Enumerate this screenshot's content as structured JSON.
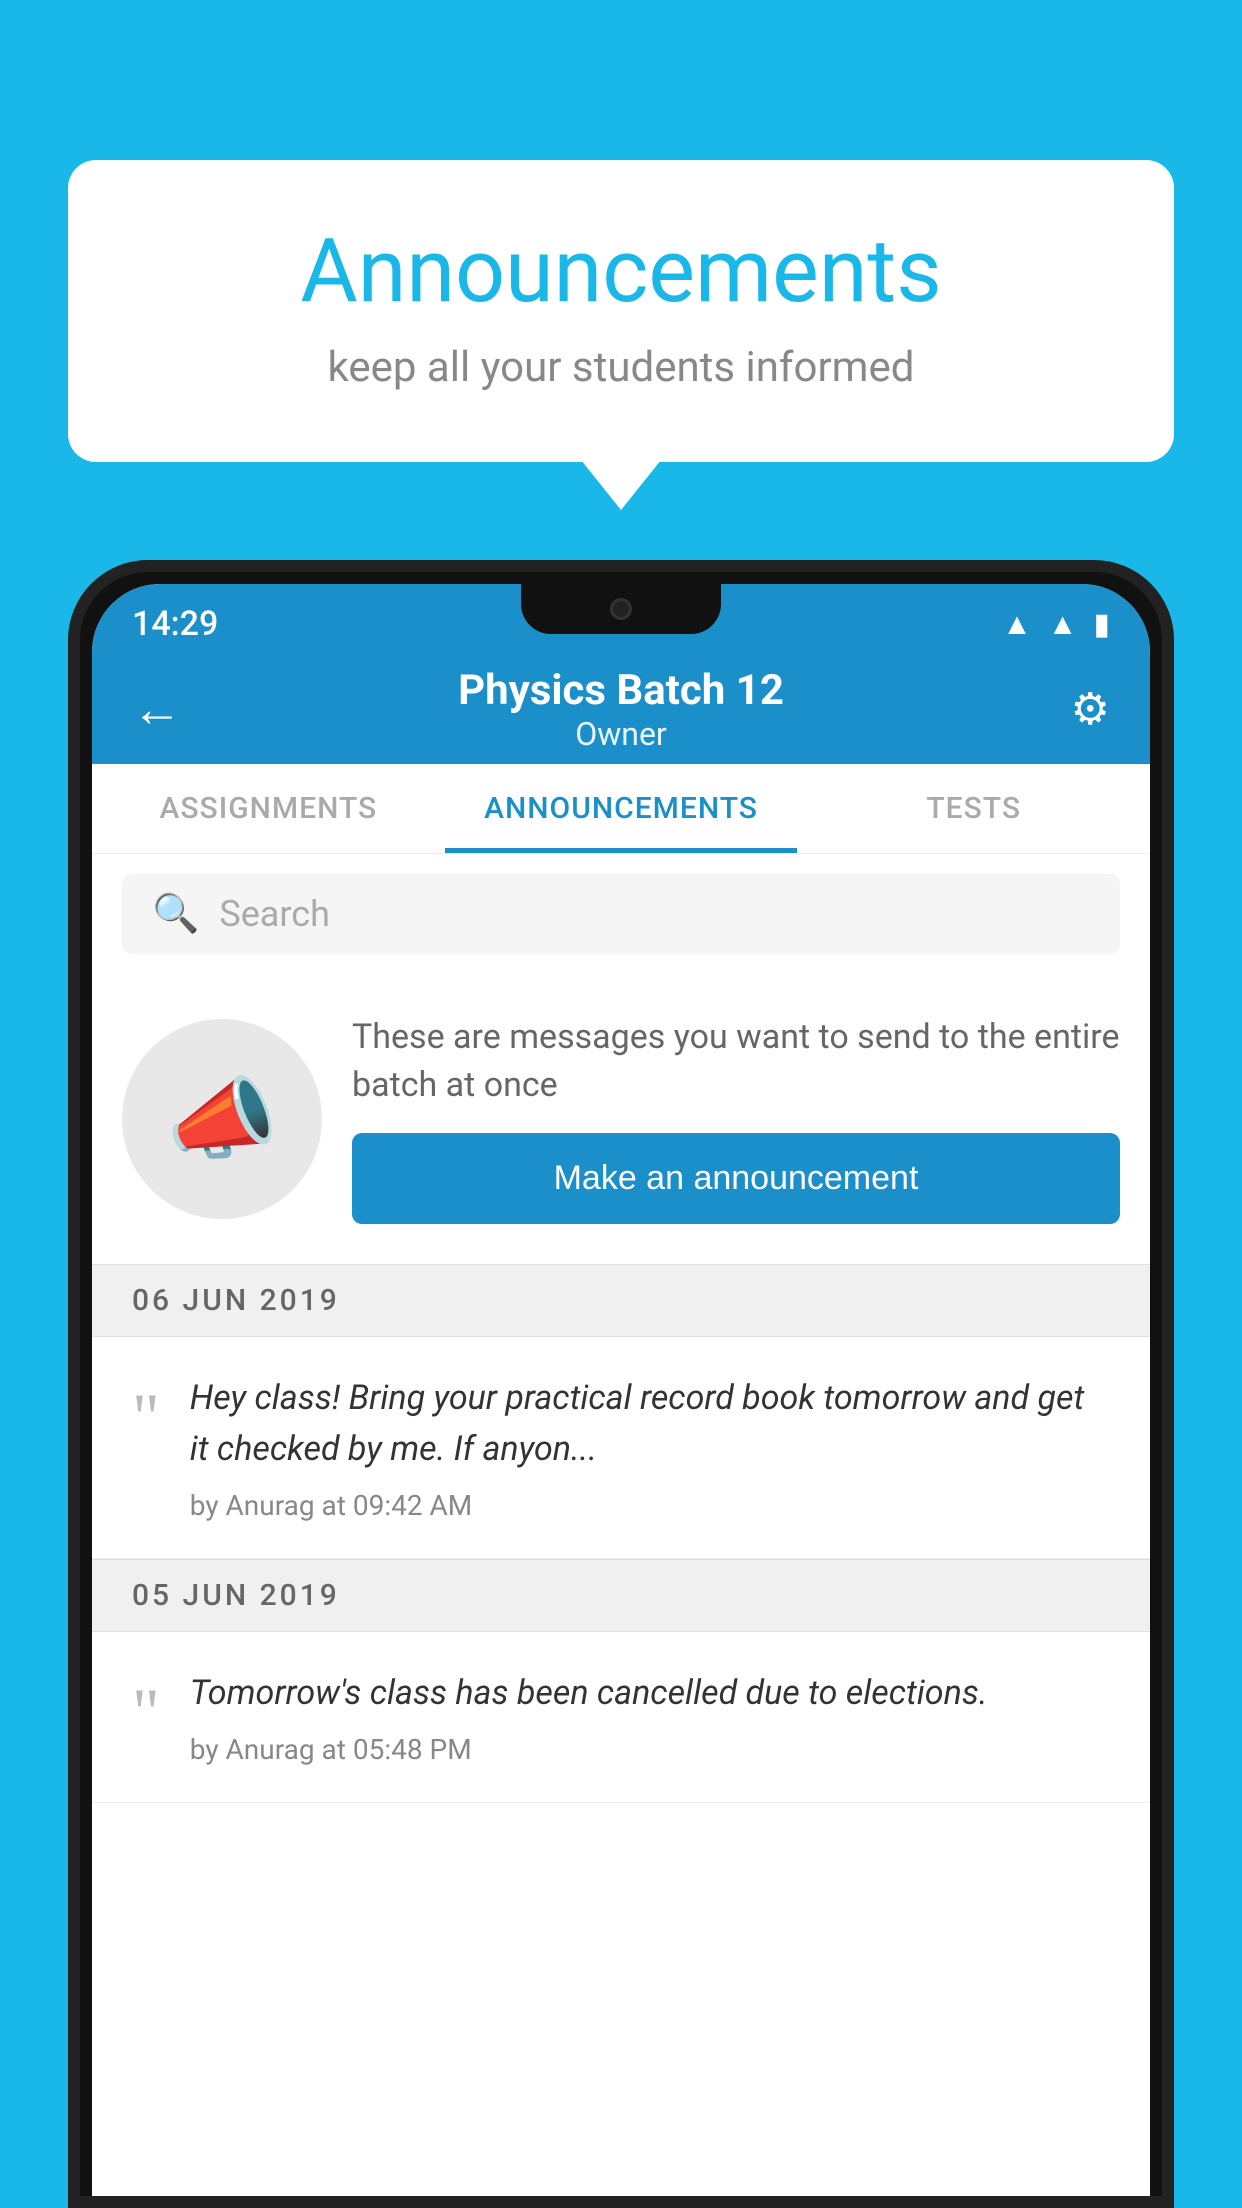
{
  "background_color": "#1ab8e8",
  "speech_bubble": {
    "title": "Announcements",
    "subtitle": "keep all your students informed"
  },
  "phone": {
    "status_bar": {
      "time": "14:29",
      "icons": [
        "wifi",
        "signal",
        "battery"
      ]
    },
    "app_bar": {
      "title": "Physics Batch 12",
      "subtitle": "Owner",
      "back_icon": "←",
      "settings_icon": "⚙"
    },
    "tabs": [
      {
        "label": "ASSIGNMENTS",
        "active": false
      },
      {
        "label": "ANNOUNCEMENTS",
        "active": true
      },
      {
        "label": "TESTS",
        "active": false
      }
    ],
    "search": {
      "placeholder": "Search"
    },
    "promo": {
      "description": "These are messages you want to send to the entire batch at once",
      "button_label": "Make an announcement"
    },
    "announcements": [
      {
        "date": "06  JUN  2019",
        "text": "Hey class! Bring your practical record book tomorrow and get it checked by me. If anyon...",
        "meta": "by Anurag at 09:42 AM"
      },
      {
        "date": "05  JUN  2019",
        "text": "Tomorrow's class has been cancelled due to elections.",
        "meta": "by Anurag at 05:48 PM"
      }
    ]
  }
}
